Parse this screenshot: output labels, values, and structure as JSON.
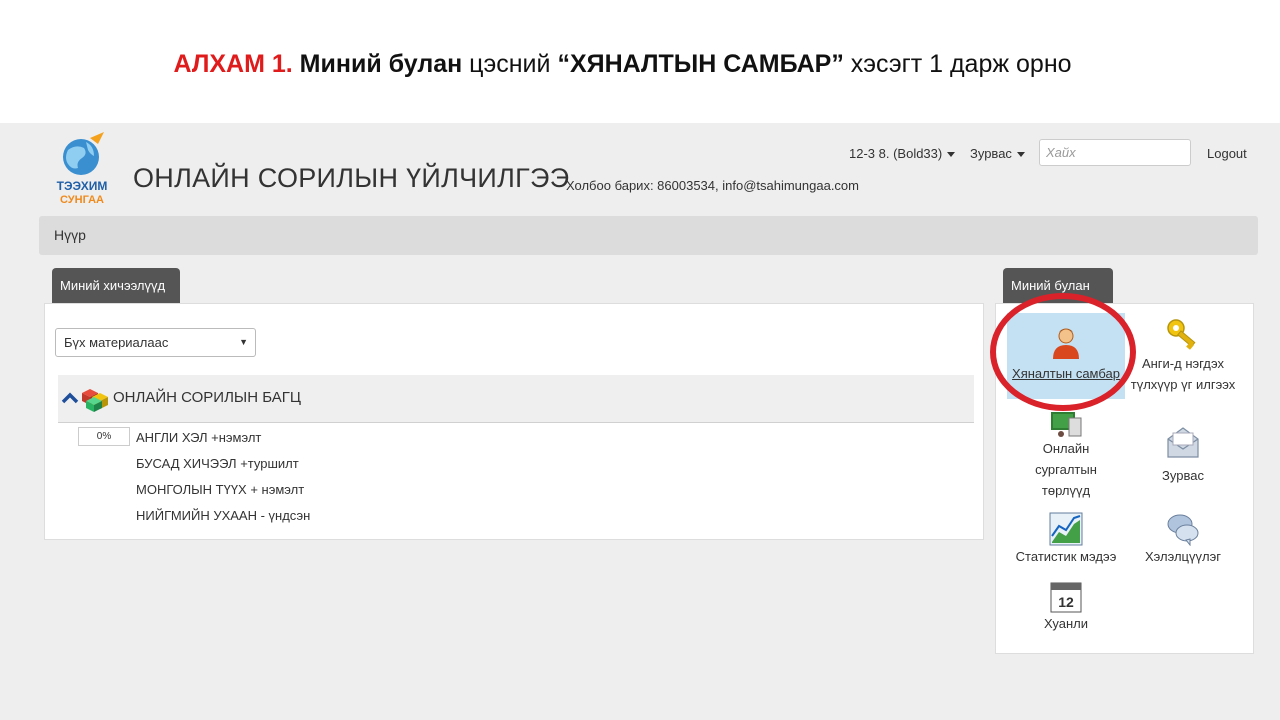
{
  "instruction": {
    "step": "АЛХАМ 1.",
    "part1": "Миний булан",
    "part2": " цэсний ",
    "part3": "“ХЯНАЛТЫН САМБАР”",
    "part4": " хэсэгт 1 дарж орно"
  },
  "header": {
    "logo_text_top": "ТЭЭХИМ",
    "logo_text_bottom": "СУНГАА",
    "title": "ОНЛАЙН СОРИЛЫН ҮЙЛЧИЛГЭЭ",
    "contact": "Холбоо барих: 86003534, info@tsahimungaa.com",
    "user_menu": "12-3 8. (Bold33)",
    "messages_menu": "Зурвас",
    "search_placeholder": "Хайх",
    "logout": "Logout"
  },
  "breadcrumb": {
    "home": "Нүүр"
  },
  "left": {
    "tab": "Миний хичээлүүд",
    "filter_selected": "Бүх материалаас",
    "package_title": "ОНЛАЙН СОРИЛЫН БАГЦ",
    "courses": [
      {
        "name": "АНГЛИ ХЭЛ +нэмэлт",
        "progress": "0%"
      },
      {
        "name": "БУСАД ХИЧЭЭЛ +туршилт"
      },
      {
        "name": "МОНГОЛЫН ТҮҮХ + нэмэлт"
      },
      {
        "name": "НИЙГМИЙН УХААН - үндсэн"
      }
    ]
  },
  "right": {
    "tab": "Миний булан",
    "tiles": {
      "dashboard": "Хяналтын самбар",
      "class_key_line1": "Анги-д нэгдэх",
      "class_key_line2": "түлхүүр үг илгээх",
      "courses_line1": "Онлайн",
      "courses_line2": "сургалтын",
      "courses_line3": "төрлүүд",
      "messages": "Зурвас",
      "statistics": "Статистик мэдээ",
      "chat": "Хэлэлцүүлэг",
      "calendar": "Хуанли",
      "calendar_day": "12"
    }
  },
  "colors": {
    "highlight_ring": "#d9222a",
    "step_red": "#e01b1b",
    "tile_active": "#c4e1f3"
  }
}
